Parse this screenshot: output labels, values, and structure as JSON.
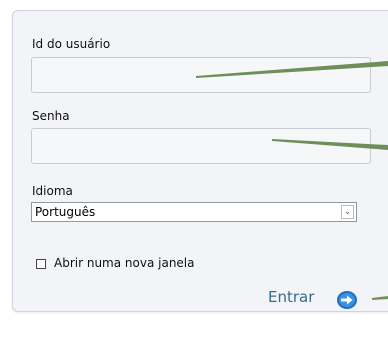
{
  "form": {
    "user_id_label": "Id do usuário",
    "user_id_value": "",
    "password_label": "Senha",
    "password_value": "",
    "language_label": "Idioma",
    "language_selected": "Português",
    "new_window_label": "Abrir numa nova janela",
    "new_window_checked": false,
    "submit_label": "Entrar"
  },
  "colors": {
    "panel_bg": "#f2f4f8",
    "submit_text": "#3a6b8e",
    "submit_icon": "#1f6fc4",
    "callout_line": "#6f8f5a"
  },
  "icons": {
    "dropdown": "chevron-down-icon",
    "submit": "arrow-right-circle-icon"
  }
}
